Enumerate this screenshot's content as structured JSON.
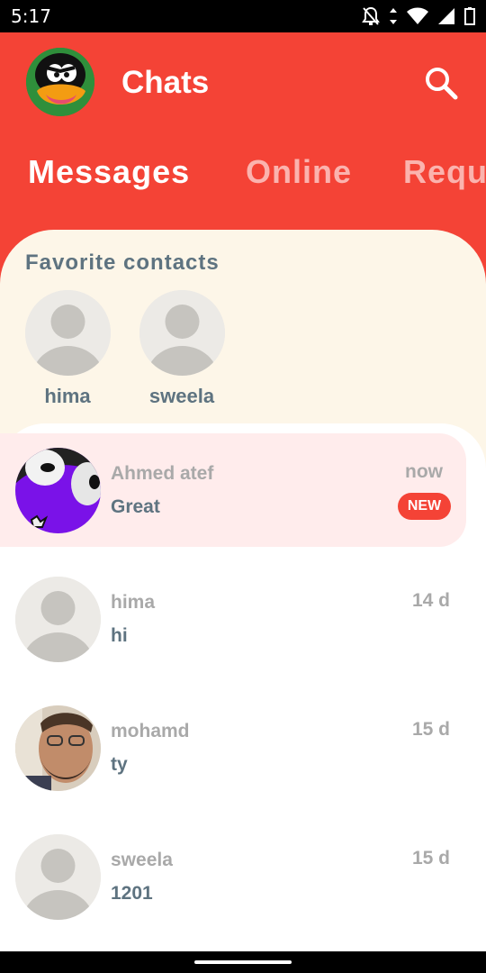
{
  "status_bar": {
    "time": "5:17"
  },
  "header": {
    "title": "Chats"
  },
  "tabs": [
    {
      "label": "Messages",
      "active": true
    },
    {
      "label": "Online",
      "active": false
    },
    {
      "label": "Reque",
      "active": false
    }
  ],
  "favorites": {
    "title": "Favorite contacts",
    "contacts": [
      {
        "name": "hima"
      },
      {
        "name": "sweela"
      }
    ]
  },
  "chats": [
    {
      "name": "Ahmed atef",
      "message": "Great",
      "time": "now",
      "badge": "NEW",
      "unread": true
    },
    {
      "name": "hima",
      "message": "hi",
      "time": "14 d",
      "unread": false
    },
    {
      "name": "mohamd",
      "message": "ty",
      "time": "15 d",
      "unread": false
    },
    {
      "name": "sweela",
      "message": "1201",
      "time": "15 d",
      "unread": false
    }
  ],
  "colors": {
    "primary": "#f44336",
    "favorites_bg": "#fdf6e8",
    "unread_bg": "#ffecec",
    "text_muted": "#a9a9a9",
    "text_slate": "#5e7380"
  }
}
